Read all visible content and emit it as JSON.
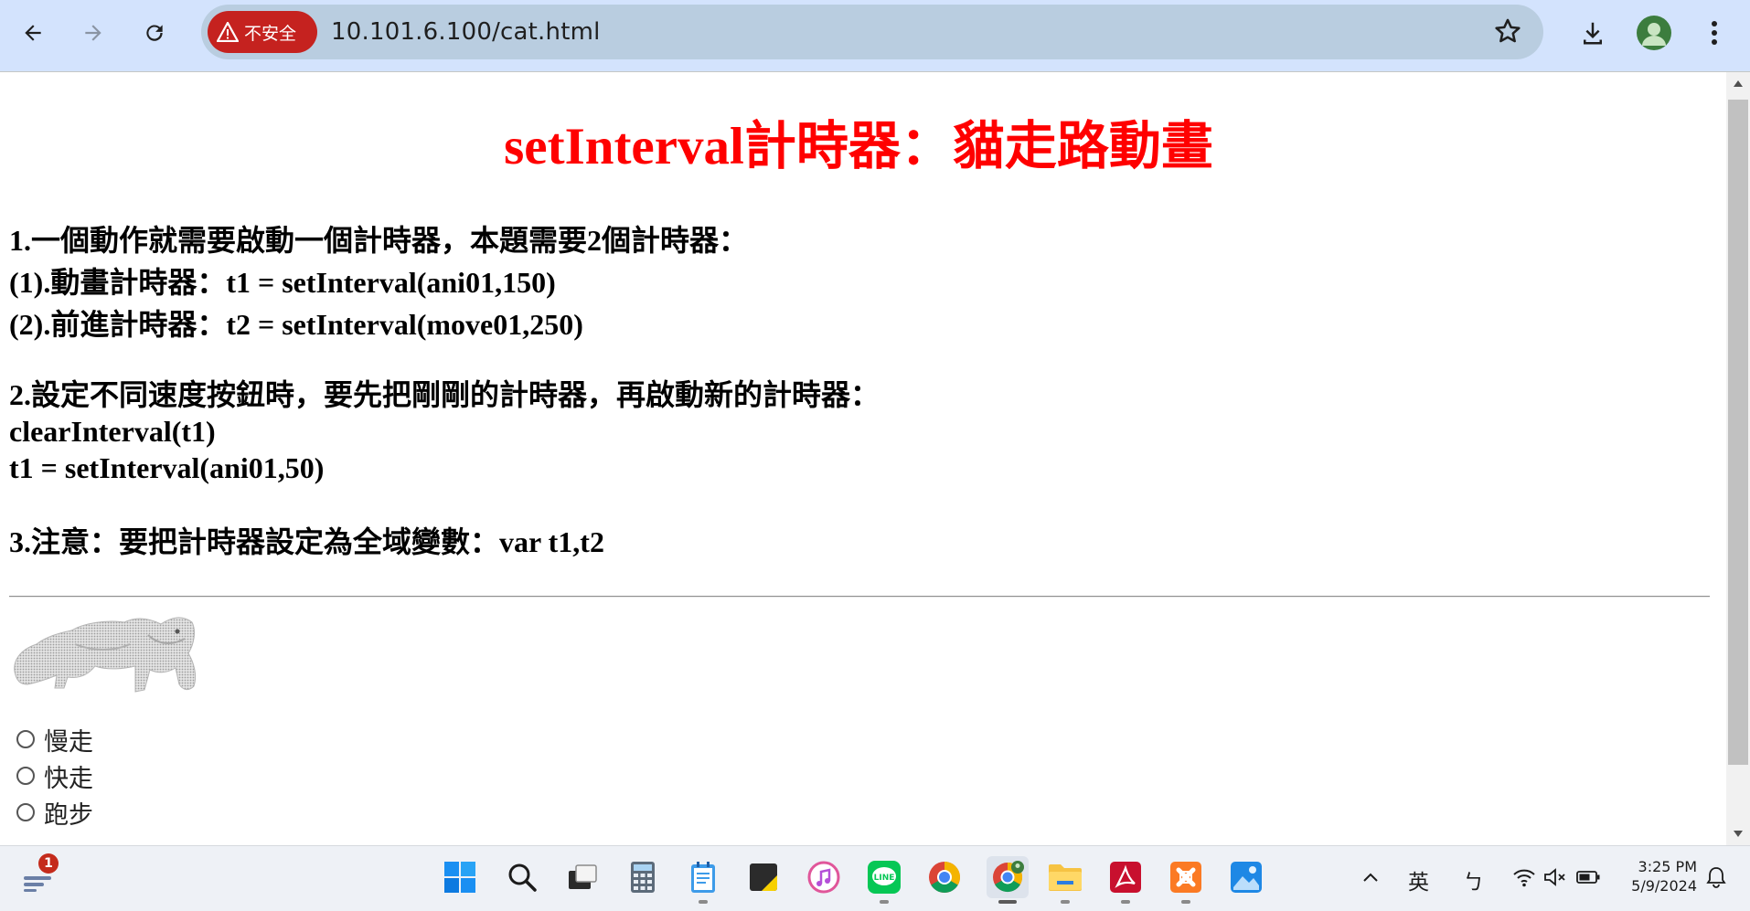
{
  "browser": {
    "security_label": "不安全",
    "url": "10.101.6.100/cat.html"
  },
  "page": {
    "title": "setInterval計時器：貓走路動畫",
    "section1": [
      "1.一個動作就需要啟動一個計時器，本題需要2個計時器：",
      "(1).動畫計時器：t1 = setInterval(ani01,150)",
      "(2).前進計時器：t2 = setInterval(move01,250)"
    ],
    "section2": [
      "2.設定不同速度按鈕時，要先把剛剛的計時器，再啟動新的計時器：",
      "clearInterval(t1)",
      "t1 = setInterval(ani01,50)"
    ],
    "section3": "3.注意：要把計時器設定為全域變數：var t1,t2",
    "radios": [
      {
        "label": "慢走",
        "checked": false
      },
      {
        "label": "快走",
        "checked": false
      },
      {
        "label": "跑步",
        "checked": false
      }
    ]
  },
  "taskbar": {
    "notification_badge": "1",
    "apps": [
      "windows-start",
      "search",
      "task-view",
      "calculator",
      "notepad",
      "sticky-notes",
      "itunes",
      "line",
      "chrome",
      "chrome-profile",
      "file-explorer",
      "acrobat",
      "xampp",
      "photos"
    ],
    "ime_language": "英",
    "ime_mode": "ㄅ",
    "time": "3:25 PM",
    "date": "5/9/2024"
  },
  "colors": {
    "title_red": "#ff0000",
    "toolbar_bg": "#d3e3fd",
    "security_chip": "#c5221f"
  }
}
